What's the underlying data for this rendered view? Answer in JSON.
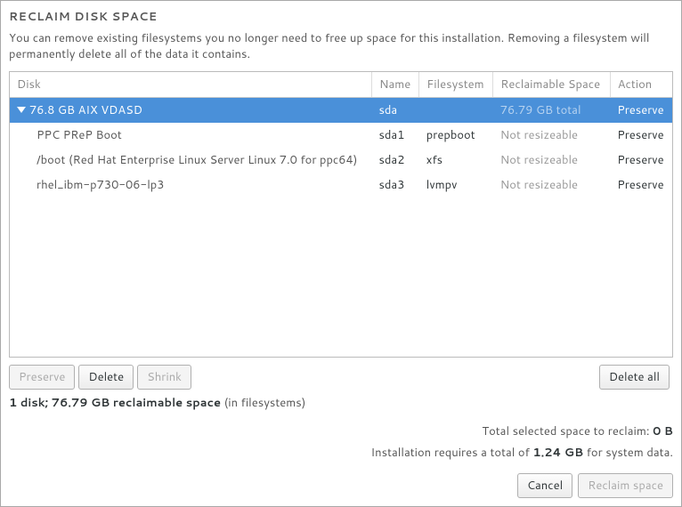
{
  "title": "RECLAIM DISK SPACE",
  "description": "You can remove existing filesystems you no longer need to free up space for this installation.  Removing a filesystem will permanently delete all of the data it contains.",
  "columns": {
    "disk": "Disk",
    "name": "Name",
    "filesystem": "Filesystem",
    "reclaimable": "Reclaimable Space",
    "action": "Action"
  },
  "rows": [
    {
      "disk": "76.8 GB AIX VDASD",
      "name": "sda",
      "filesystem": "",
      "reclaimable": "76.79 GB total",
      "action": "Preserve",
      "selected": true,
      "level": 0,
      "expandable": true
    },
    {
      "disk": "PPC PReP Boot",
      "name": "sda1",
      "filesystem": "prepboot",
      "reclaimable": "Not resizeable",
      "action": "Preserve",
      "selected": false,
      "level": 1,
      "expandable": false
    },
    {
      "disk": "/boot (Red Hat Enterprise Linux Server Linux 7.0 for ppc64)",
      "name": "sda2",
      "filesystem": "xfs",
      "reclaimable": "Not resizeable",
      "action": "Preserve",
      "selected": false,
      "level": 1,
      "expandable": false
    },
    {
      "disk": "rhel_ibm-p730-06-lp3",
      "name": "sda3",
      "filesystem": "lvmpv",
      "reclaimable": "Not resizeable",
      "action": "Preserve",
      "selected": false,
      "level": 1,
      "expandable": false
    }
  ],
  "actions": {
    "preserve": "Preserve",
    "delete": "Delete",
    "shrink": "Shrink",
    "delete_all": "Delete all"
  },
  "summary_prefix": "1 disk; 76.79 GB reclaimable space",
  "summary_suffix": " (in filesystems)",
  "total_line_prefix": "Total selected space to reclaim: ",
  "total_value": "0 B",
  "install_line_prefix": "Installation requires a total of ",
  "install_value": "1.24 GB",
  "install_line_suffix": " for system data.",
  "footer": {
    "cancel": "Cancel",
    "reclaim": "Reclaim space"
  }
}
